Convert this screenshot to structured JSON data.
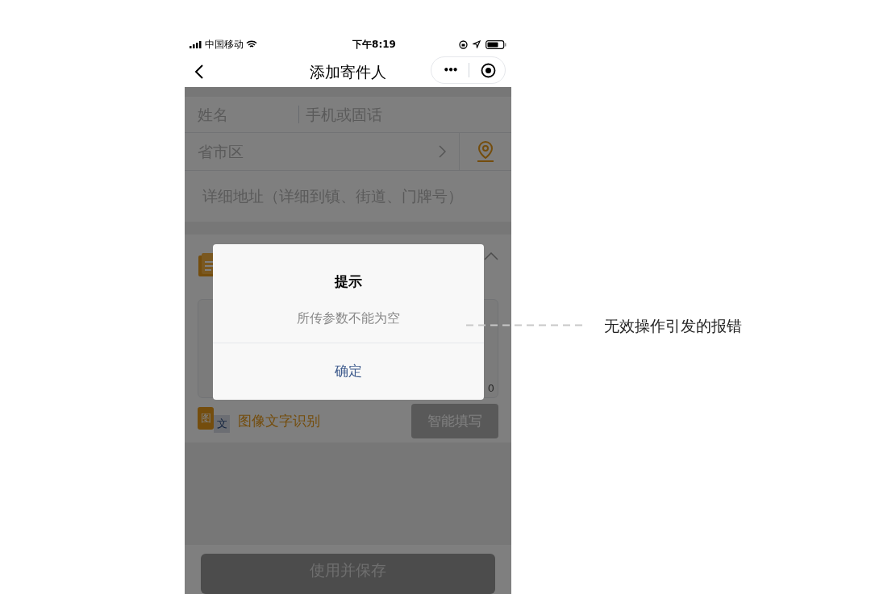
{
  "status_bar": {
    "carrier": "中国移动",
    "time": "下午8:19"
  },
  "nav": {
    "title": "添加寄件人",
    "more": "•••"
  },
  "form": {
    "name_placeholder": "姓名",
    "phone_placeholder": "手机或固话",
    "region_placeholder": "省市区",
    "address_placeholder": "详细地址（详细到镇、街道、门牌号）"
  },
  "smart_fill": {
    "counter": "0",
    "ocr_icon": [
      "图",
      "文"
    ],
    "ocr_label": "图像文字识别",
    "button": "智能填写"
  },
  "save_button": "使用并保存",
  "dialog": {
    "title": "提示",
    "message": "所传参数不能为空",
    "confirm": "确定"
  },
  "annotation": "无效操作引发的报错"
}
